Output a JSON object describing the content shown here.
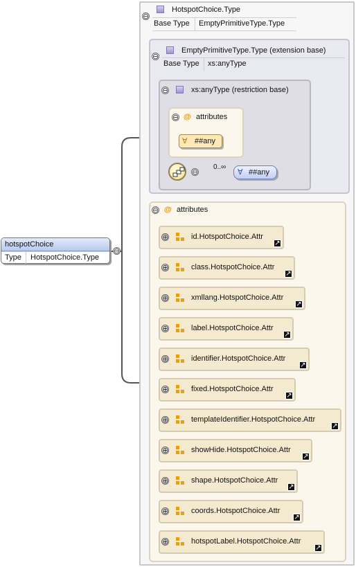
{
  "type_box": {
    "name": "HotspotChoice.Type",
    "base_type_label": "Base Type",
    "base_type_value": "EmptyPrimitiveType.Type"
  },
  "extension": {
    "name": "EmptyPrimitiveType.Type (extension base)",
    "base_type_label": "Base Type",
    "base_type_value": "xs:anyType"
  },
  "restriction": {
    "name": "xs:anyType (restriction base)",
    "attributes_label": "attributes",
    "any_attribute": "##any",
    "cardinality": "0..∞",
    "any_element": "##any"
  },
  "attributes": {
    "label": "attributes",
    "items": [
      {
        "name": "id.HotspotChoice.Attr"
      },
      {
        "name": "class.HotspotChoice.Attr"
      },
      {
        "name": "xmllang.HotspotChoice.Attr"
      },
      {
        "name": "label.HotspotChoice.Attr"
      },
      {
        "name": "identifier.HotspotChoice.Attr"
      },
      {
        "name": "fixed.HotspotChoice.Attr"
      },
      {
        "name": "templateIdentifier.HotspotChoice.Attr"
      },
      {
        "name": "showHide.HotspotChoice.Attr"
      },
      {
        "name": "shape.HotspotChoice.Attr"
      },
      {
        "name": "coords.HotspotChoice.Attr"
      },
      {
        "name": "hotspotLabel.HotspotChoice.Attr"
      }
    ]
  },
  "root_element": {
    "name": "hotspotChoice",
    "type_label": "Type",
    "type_value": "HotspotChoice.Type"
  },
  "symbols": {
    "at": "@",
    "minus": "⊖",
    "plus": "⊕",
    "forall": "∀",
    "link": "↗"
  },
  "colors": {
    "attr_icon": "#e8a010",
    "element_header": "#b8c9ee",
    "type_icon": "#9f95cc"
  }
}
